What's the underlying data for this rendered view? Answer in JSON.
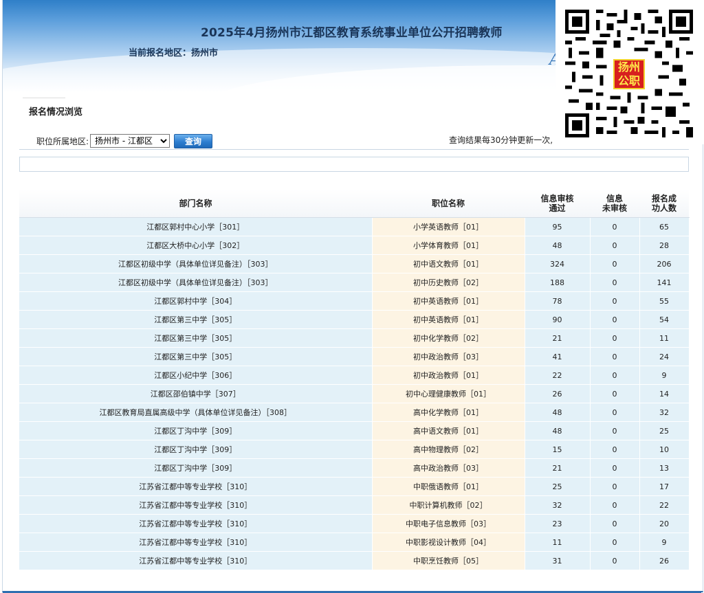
{
  "header": {
    "title": "2025年4月扬州市江都区教育系统事业单位公开招聘教师",
    "region_line": "当前报名地区：扬州市",
    "qr_badge": "扬州公职"
  },
  "section": {
    "title": "报名情况浏览"
  },
  "filter": {
    "label": "职位所属地区:",
    "selected": "扬州市 - 江都区",
    "query_button": "查询",
    "update_note": "查询结果每30分钟更新一次,"
  },
  "table": {
    "headers": {
      "dept": "部门名称",
      "position": "职位名称",
      "reviewed": [
        "信息审核",
        "通过"
      ],
      "unreviewed": [
        "信息",
        "未审核"
      ],
      "success": [
        "报名成",
        "功人数"
      ]
    },
    "rows": [
      [
        "江都区郭村中心小学［301］",
        "小学英语教师［01］",
        "95",
        "0",
        "65"
      ],
      [
        "江都区大桥中心小学［302］",
        "小学体育教师［01］",
        "48",
        "0",
        "28"
      ],
      [
        "江都区初级中学（具体单位详见备注）［303］",
        "初中语文教师［01］",
        "324",
        "0",
        "206"
      ],
      [
        "江都区初级中学（具体单位详见备注）［303］",
        "初中历史教师［02］",
        "188",
        "0",
        "141"
      ],
      [
        "江都区郭村中学［304］",
        "初中英语教师［01］",
        "78",
        "0",
        "55"
      ],
      [
        "江都区第三中学［305］",
        "初中英语教师［01］",
        "90",
        "0",
        "54"
      ],
      [
        "江都区第三中学［305］",
        "初中化学教师［02］",
        "21",
        "0",
        "11"
      ],
      [
        "江都区第三中学［305］",
        "初中政治教师［03］",
        "41",
        "0",
        "24"
      ],
      [
        "江都区小纪中学［306］",
        "初中政治教师［01］",
        "22",
        "0",
        "9"
      ],
      [
        "江都区邵伯镇中学［307］",
        "初中心理健康教师［01］",
        "26",
        "0",
        "14"
      ],
      [
        "江都区教育局直属高级中学（具体单位详见备注）［308］",
        "高中化学教师［01］",
        "48",
        "0",
        "32"
      ],
      [
        "江都区丁沟中学［309］",
        "高中语文教师［01］",
        "48",
        "0",
        "25"
      ],
      [
        "江都区丁沟中学［309］",
        "高中物理教师［02］",
        "15",
        "0",
        "10"
      ],
      [
        "江都区丁沟中学［309］",
        "高中政治教师［03］",
        "21",
        "0",
        "13"
      ],
      [
        "江苏省江都中等专业学校［310］",
        "中职俄语教师［01］",
        "25",
        "0",
        "17"
      ],
      [
        "江苏省江都中等专业学校［310］",
        "中职计算机教师［02］",
        "32",
        "0",
        "22"
      ],
      [
        "江苏省江都中等专业学校［310］",
        "中职电子信息教师［03］",
        "23",
        "0",
        "20"
      ],
      [
        "江苏省江都中等专业学校［310］",
        "中职影视设计教师［04］",
        "11",
        "0",
        "9"
      ],
      [
        "江苏省江都中等专业学校［310］",
        "中职烹饪教师［05］",
        "31",
        "0",
        "26"
      ]
    ]
  }
}
